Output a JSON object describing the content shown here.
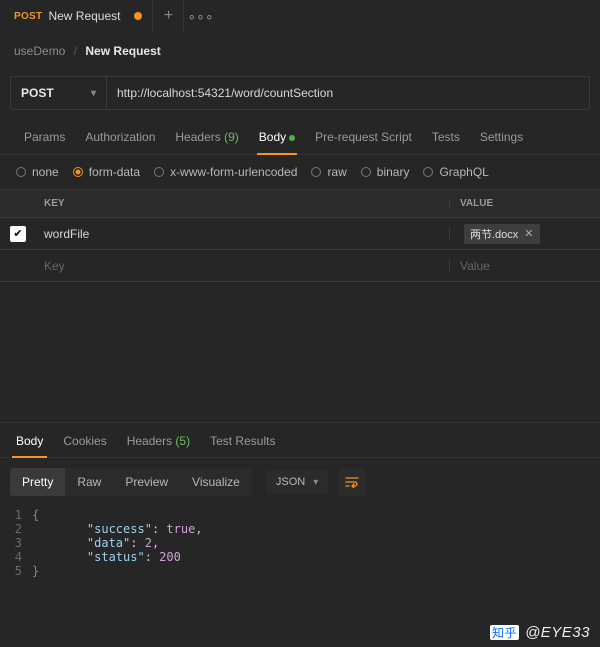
{
  "tab": {
    "method": "POST",
    "title": "New Request"
  },
  "breadcrumb": {
    "workspace": "useDemo",
    "current": "New Request"
  },
  "request": {
    "method": "POST",
    "url": "http://localhost:54321/word/countSection",
    "tabs": {
      "params": "Params",
      "auth": "Authorization",
      "headers_label": "Headers",
      "headers_count": "(9)",
      "body": "Body",
      "prerequest": "Pre-request Script",
      "tests": "Tests",
      "settings": "Settings"
    },
    "body_types": {
      "none": "none",
      "formdata": "form-data",
      "urlencoded": "x-www-form-urlencoded",
      "raw": "raw",
      "binary": "binary",
      "graphql": "GraphQL"
    },
    "table": {
      "head_key": "KEY",
      "head_value": "VALUE",
      "rows": [
        {
          "key": "wordFile",
          "file": "两节.docx"
        }
      ],
      "placeholder_key": "Key",
      "placeholder_value": "Value"
    }
  },
  "response": {
    "tabs": {
      "body": "Body",
      "cookies": "Cookies",
      "headers_label": "Headers",
      "headers_count": "(5)",
      "testresults": "Test Results"
    },
    "viewmodes": {
      "pretty": "Pretty",
      "raw": "Raw",
      "preview": "Preview",
      "visualize": "Visualize"
    },
    "format": "JSON",
    "body_lines": {
      "l2_key": "\"success\"",
      "l2_val": "true",
      "l3_key": "\"data\"",
      "l3_val": "2",
      "l4_key": "\"status\"",
      "l4_val": "200"
    }
  },
  "watermark": {
    "logo": "知乎",
    "text": "@EYE33"
  }
}
